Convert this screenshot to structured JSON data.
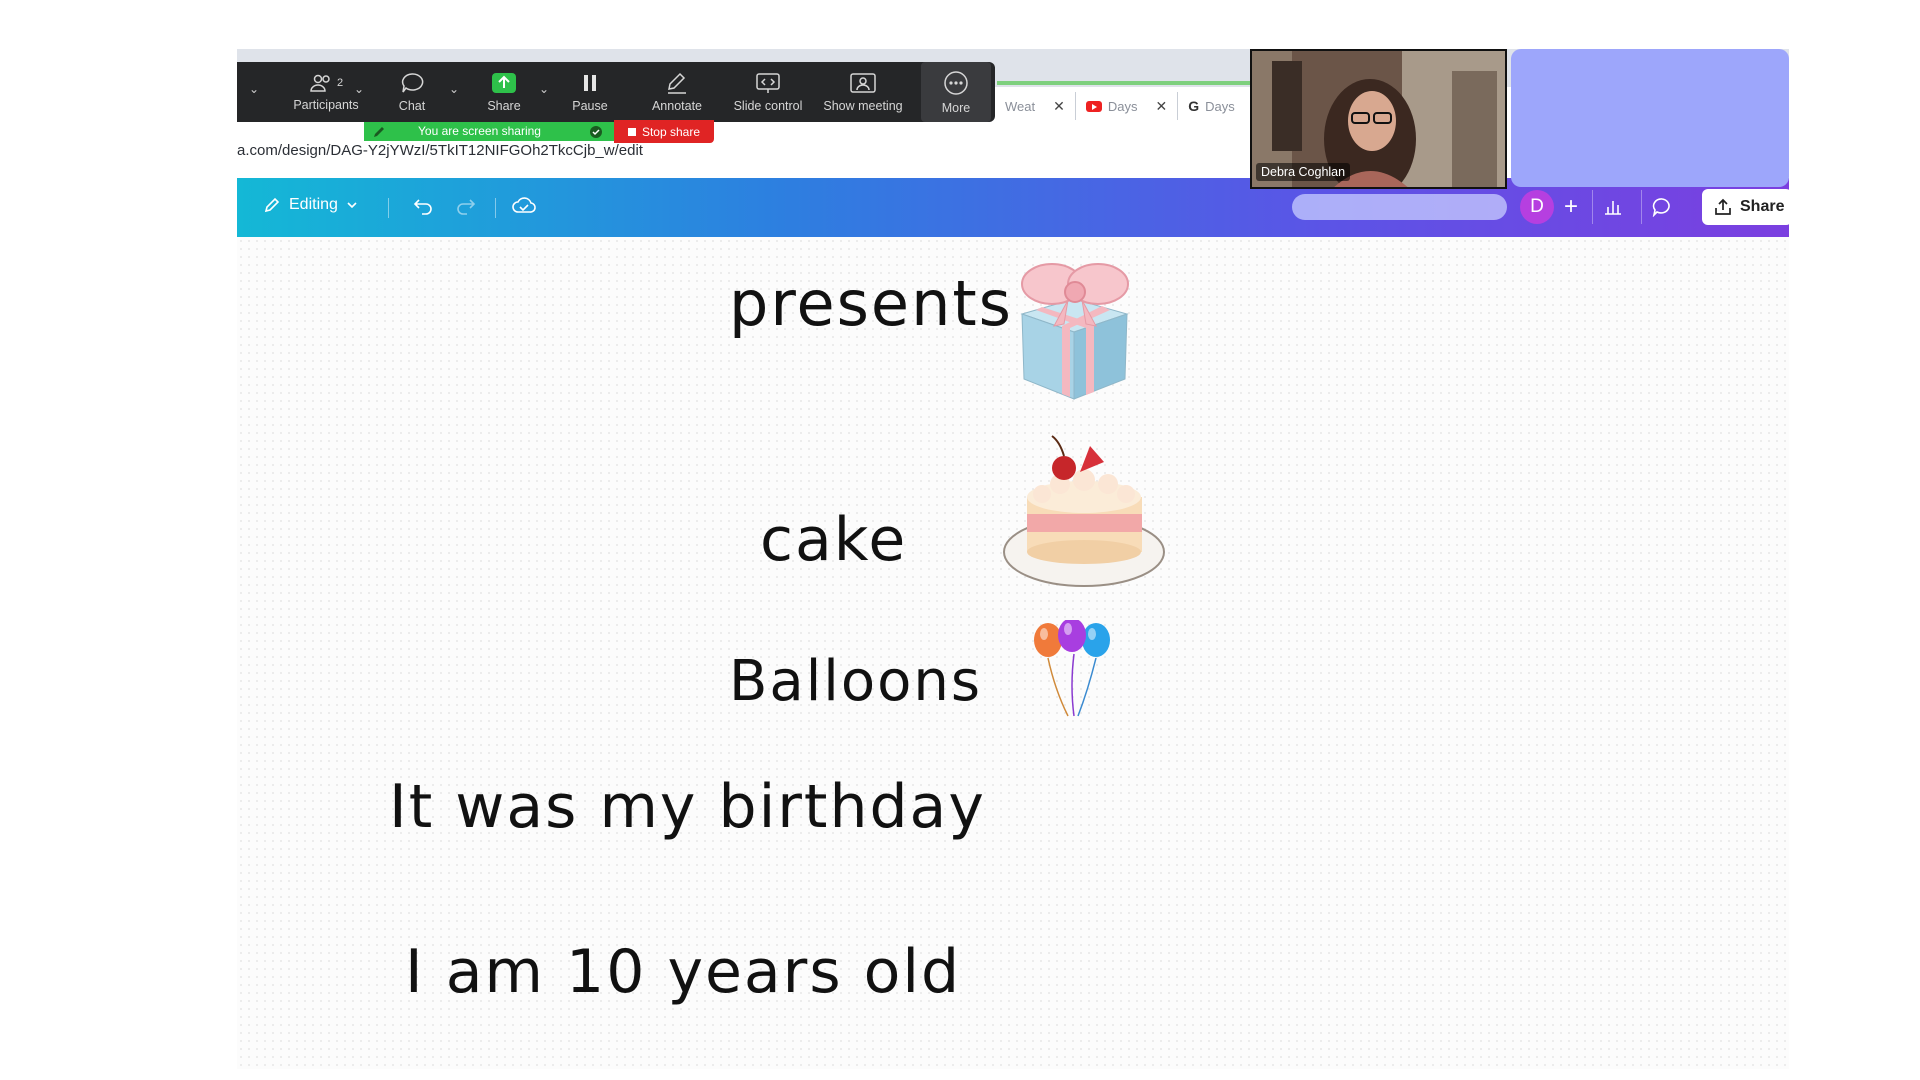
{
  "zoom_toolbar": {
    "participants_count": "2",
    "participants_label": "Participants",
    "chat_label": "Chat",
    "share_label": "Share",
    "pause_label": "Pause",
    "annotate_label": "Annotate",
    "slide_control_label": "Slide control",
    "show_meeting_label": "Show meeting",
    "more_label": "More",
    "sharing_banner": "You are screen sharing",
    "stop_share_label": "Stop share"
  },
  "browser": {
    "tabs": [
      {
        "label": "Weat",
        "icon": "weather-icon"
      },
      {
        "label": "Days",
        "icon": "youtube-icon"
      },
      {
        "label": "Days",
        "icon": "google-icon"
      }
    ],
    "url": "a.com/design/DAG-Y2jYWzI/5TkIT12NIFGOh2TkcCjb_w/edit"
  },
  "canva_toolbar": {
    "editing_label": "Editing",
    "avatar_initial": "D",
    "plus": "+",
    "share_label": "Share"
  },
  "video": {
    "participant_name": "Debra Coghlan"
  },
  "document": {
    "words": [
      "presents",
      "cake",
      "Balloons",
      "It was my birthday",
      "I am 10 years old"
    ]
  },
  "colors": {
    "zoom_bar": "#252628",
    "sharing_green": "#2ec14a",
    "stop_red": "#e02424",
    "canva_gradient_start": "#14b8d6",
    "canva_gradient_end": "#7b3fe0",
    "empty_tile": "#9da6fb"
  }
}
